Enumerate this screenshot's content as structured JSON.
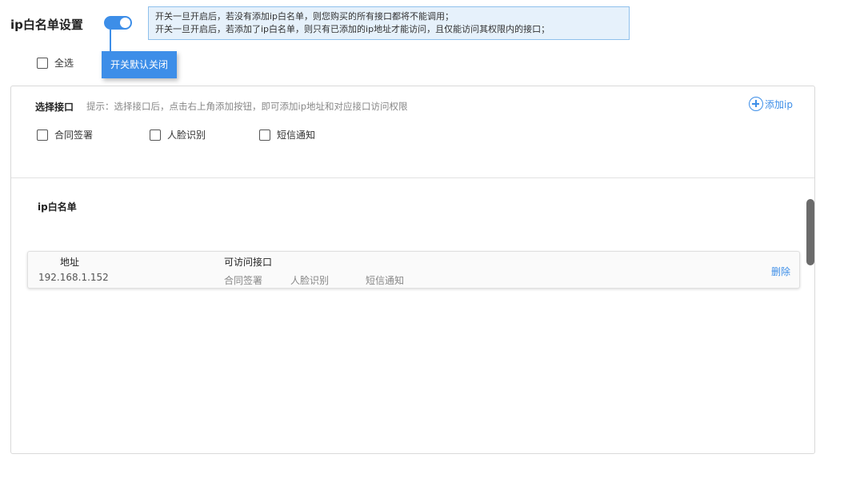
{
  "page_title": "ip白名单设置",
  "toggle": {
    "on": true,
    "tooltip": "开关默认关闭"
  },
  "hint": {
    "line1": "开关一旦开启后，若没有添加ip白名单，则您购买的所有接口都将不能调用；",
    "line2": "开关一旦开启后，若添加了ip白名单，则只有已添加的ip地址才能访问，且仅能访问其权限内的接口；"
  },
  "select_all_label": "全选",
  "interface_section": {
    "label": "选择接口",
    "hint": "提示：选择接口后，点击右上角添加按钮，即可添加ip地址和对应接口访问权限",
    "add_label": "添加ip",
    "options": [
      "合同签署",
      "人脸识别",
      "短信通知"
    ]
  },
  "whitelist": {
    "title": "ip白名单",
    "address_header": "地址",
    "interfaces_header": "可访问接口",
    "rows": [
      {
        "address": "192.168.1.152",
        "interfaces": [
          "合同签署",
          "人脸识别",
          "短信通知"
        ],
        "delete_label": "删除"
      }
    ]
  },
  "colors": {
    "accent": "#3d8ee8",
    "hint_bg": "#e6f1fb",
    "hint_border": "#8fc0ec"
  }
}
